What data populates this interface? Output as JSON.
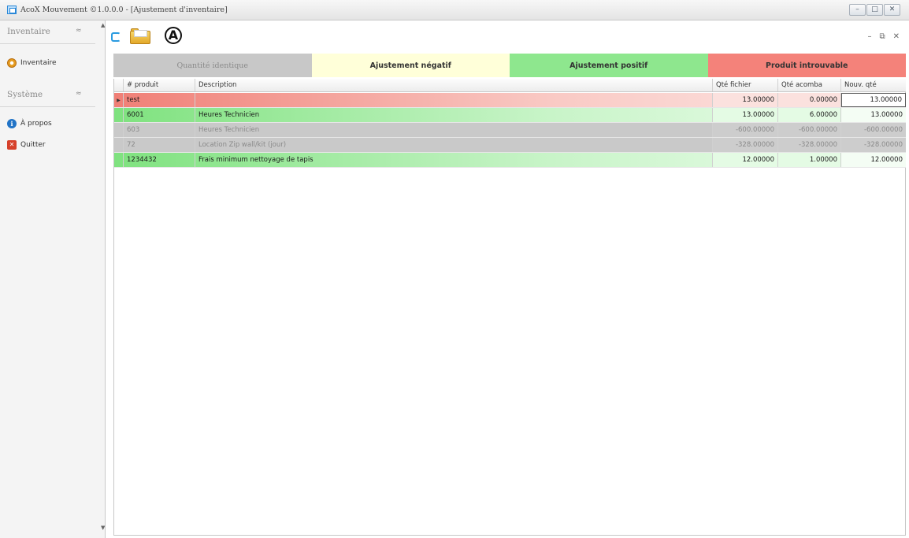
{
  "window": {
    "title": "AcoX Mouvement ©1.0.0.0 - [Ajustement d'inventaire]",
    "controls": {
      "minimize": "–",
      "maximize": "□",
      "close": "✕"
    }
  },
  "nav": {
    "groups": [
      {
        "title": "Inventaire",
        "collapse_glyph": "≈",
        "items": [
          {
            "label": "Inventaire",
            "icon": "gear-icon"
          }
        ]
      },
      {
        "title": "Système",
        "collapse_glyph": "≈",
        "items": [
          {
            "label": "À propos",
            "icon": "info-icon"
          },
          {
            "label": "Quitter",
            "icon": "exit-icon"
          }
        ]
      }
    ]
  },
  "toolbar": {
    "buttons": [
      {
        "name": "refresh",
        "icon": "refresh-icon"
      },
      {
        "name": "open-file",
        "icon": "open-folder-icon"
      },
      {
        "name": "acomba",
        "icon": "anarchy-a-icon",
        "glyph": "A"
      }
    ],
    "mdi_controls": {
      "minimize": "–",
      "restore": "⧉",
      "close": "✕"
    }
  },
  "legend": {
    "identique": "Quantité identique",
    "negatif": "Ajustement négatif",
    "positif": "Ajustement positif",
    "introuvable": "Produit introuvable"
  },
  "colors": {
    "identique": "#c8c8c8",
    "negatif": "#ffffd9",
    "positif": "#8ee78e",
    "introuvable": "#f4827a"
  },
  "grid": {
    "columns": [
      "# produit",
      "Description",
      "Qté fichier",
      "Qté acomba",
      "Nouv. qté"
    ],
    "rows": [
      {
        "status": "introuvable",
        "produit": "test",
        "description": "",
        "qte_fichier": "13.00000",
        "qte_acomba": "0.00000",
        "nouv_qte": "13.00000",
        "selected": true
      },
      {
        "status": "positif",
        "produit": "6001",
        "description": "Heures Technicien",
        "qte_fichier": "13.00000",
        "qte_acomba": "6.00000",
        "nouv_qte": "13.00000"
      },
      {
        "status": "identique",
        "produit": "603",
        "description": "Heures Technicien",
        "qte_fichier": "-600.00000",
        "qte_acomba": "-600.00000",
        "nouv_qte": "-600.00000"
      },
      {
        "status": "identique",
        "produit": "72",
        "description": "Location Zip wall/kit (jour)",
        "qte_fichier": "-328.00000",
        "qte_acomba": "-328.00000",
        "nouv_qte": "-328.00000"
      },
      {
        "status": "positif",
        "produit": "1234432",
        "description": "Frais minimum  nettoyage de tapis",
        "qte_fichier": "12.00000",
        "qte_acomba": "1.00000",
        "nouv_qte": "12.00000"
      }
    ]
  }
}
